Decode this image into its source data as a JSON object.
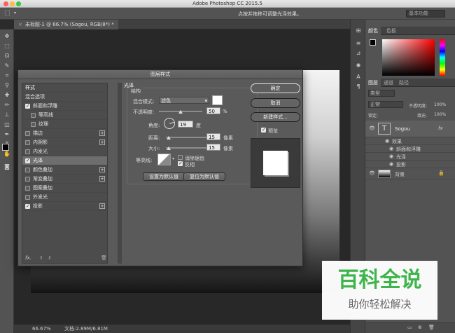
{
  "app": {
    "title": "Adobe Photoshop CC 2015.5",
    "hint": "点按并拖移可调整光泽效果。",
    "workspace": "基本功能",
    "document_tab": "未标题-1 @ 66.7% (Sogou, RGB/8*) *",
    "status_zoom": "66.67%",
    "status_doc": "文档:2.89M/6.81M"
  },
  "right_panel": {
    "color_tabs": [
      "颜色",
      "色板"
    ],
    "layers_tabs": [
      "图层",
      "通道",
      "路径"
    ],
    "kind_filter": "类型",
    "blend_mode": "正常",
    "opacity_label": "不透明度:",
    "opacity_value": "100%",
    "lock_label": "锁定:",
    "fill_label": "填充:",
    "fill_value": "100%",
    "layers": {
      "text_layer_name": "Sogou",
      "fx_label": "fx",
      "effects_label": "效果",
      "effect_items": [
        "斜面和浮雕",
        "光泽",
        "投影"
      ],
      "background_name": "背景"
    }
  },
  "dialog": {
    "title": "图层样式",
    "styles_header": "样式",
    "blend_options": "混合选项",
    "style_items": [
      {
        "label": "斜面和浮雕",
        "checked": true,
        "plus": false,
        "indent": false
      },
      {
        "label": "等高线",
        "checked": false,
        "plus": false,
        "indent": true
      },
      {
        "label": "纹理",
        "checked": false,
        "plus": false,
        "indent": true
      },
      {
        "label": "描边",
        "checked": false,
        "plus": true,
        "indent": false
      },
      {
        "label": "内阴影",
        "checked": false,
        "plus": true,
        "indent": false
      },
      {
        "label": "内发光",
        "checked": false,
        "plus": false,
        "indent": false
      },
      {
        "label": "光泽",
        "checked": true,
        "plus": false,
        "indent": false,
        "selected": true
      },
      {
        "label": "颜色叠加",
        "checked": false,
        "plus": true,
        "indent": false
      },
      {
        "label": "渐变叠加",
        "checked": false,
        "plus": true,
        "indent": false
      },
      {
        "label": "图案叠加",
        "checked": false,
        "plus": false,
        "indent": false
      },
      {
        "label": "外发光",
        "checked": false,
        "plus": false,
        "indent": false
      },
      {
        "label": "投影",
        "checked": true,
        "plus": true,
        "indent": false
      }
    ],
    "fx_label": "fx.",
    "section_title": "光泽",
    "structure_title": "结构",
    "blend_mode_label": "混合模式:",
    "blend_mode_value": "滤色",
    "opacity_label": "不透明度:",
    "opacity_value": "50",
    "opacity_fraction": 0.5,
    "percent": "%",
    "angle_label": "角度:",
    "angle_value": "19",
    "degree": "度",
    "distance_label": "距离:",
    "distance_value": "15",
    "distance_fraction": 0.06,
    "size_label": "大小:",
    "size_value": "15",
    "size_fraction": 0.06,
    "px": "像素",
    "contour_label": "等高线:",
    "antialias_label": "消除锯齿",
    "invert_label": "反相",
    "set_default": "设置为默认值",
    "reset_default": "复位为默认值",
    "ok": "确定",
    "cancel": "取消",
    "new_style": "新建样式...",
    "preview": "预览",
    "colors": {
      "gloss_color": "#ffffff",
      "fg_color": "#000000"
    }
  },
  "watermark": {
    "title": "百科全说",
    "subtitle": "助你轻松解决",
    "color": "#3db54a"
  }
}
